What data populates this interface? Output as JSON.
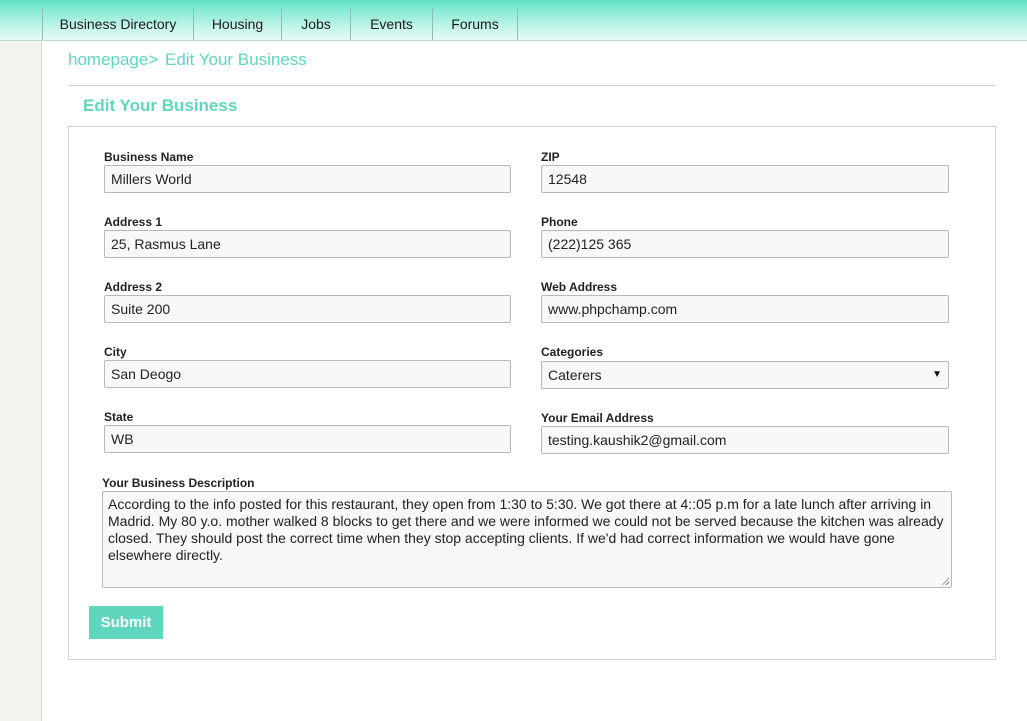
{
  "nav": {
    "items": [
      {
        "label": "Business Directory"
      },
      {
        "label": "Housing"
      },
      {
        "label": "Jobs"
      },
      {
        "label": "Events"
      },
      {
        "label": "Forums"
      }
    ]
  },
  "breadcrumb": {
    "home": "homepage",
    "separator": ">",
    "current": "Edit Your Business"
  },
  "page_title": "Edit Your Business",
  "form": {
    "business_name": {
      "label": "Business Name",
      "value": "Millers World"
    },
    "address1": {
      "label": "Address 1",
      "value": "25, Rasmus Lane"
    },
    "address2": {
      "label": "Address 2",
      "value": "Suite 200"
    },
    "city": {
      "label": "City",
      "value": "San Deogo"
    },
    "state": {
      "label": "State",
      "value": "WB"
    },
    "zip": {
      "label": "ZIP",
      "value": "12548"
    },
    "phone": {
      "label": "Phone",
      "value": "(222)125 365"
    },
    "web_address": {
      "label": "Web Address",
      "value": "www.phpchamp.com"
    },
    "categories": {
      "label": "Categories",
      "value": "Caterers"
    },
    "email": {
      "label": "Your Email Address",
      "value": "testing.kaushik2@gmail.com"
    },
    "description": {
      "label": "Your Business Description",
      "value": "According to the info posted for this restaurant, they open from 1:30 to 5:30. We got there at 4::05 p.m for a late lunch after arriving in Madrid. My 80 y.o. mother walked 8 blocks to get there and we were informed we could not be served because the kitchen was already closed. They should post the correct time when they stop accepting clients.  If we'd had correct information we would have gone elsewhere directly."
    },
    "submit_label": "Submit"
  },
  "colors": {
    "accent": "#5fd6bd",
    "nav_top": "#5fe0c4",
    "nav_bottom": "#e6fbf6"
  }
}
